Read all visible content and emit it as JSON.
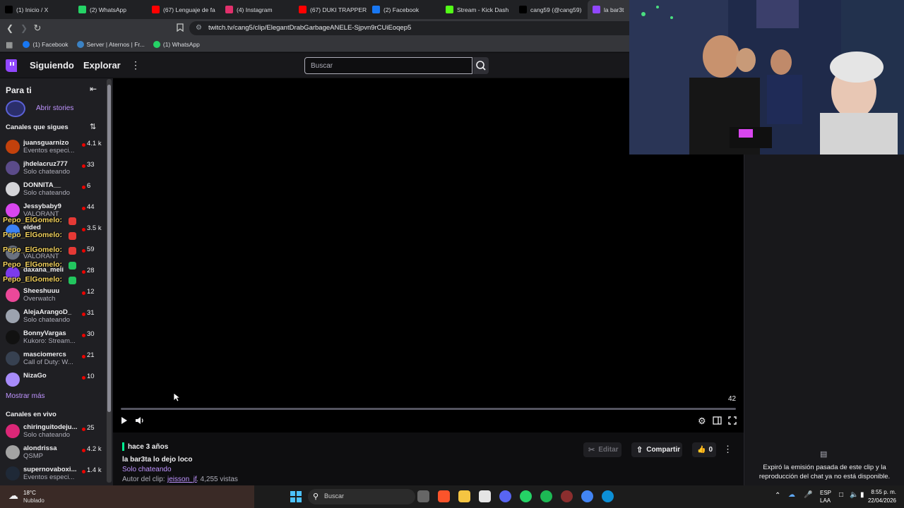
{
  "browser": {
    "tabs": [
      {
        "label": "(1) Inicio / X",
        "icon": "x-icon",
        "color": "#000000"
      },
      {
        "label": "(2) WhatsApp",
        "icon": "whatsapp-icon",
        "color": "#25d366"
      },
      {
        "label": "(67) Lenguaje de fa",
        "icon": "youtube-icon",
        "color": "#ff0000"
      },
      {
        "label": "(4) Instagram",
        "icon": "instagram-icon",
        "color": "#e1306c"
      },
      {
        "label": "(67) DUKI TRAPPER",
        "icon": "youtube-icon",
        "color": "#ff0000"
      },
      {
        "label": "(2) Facebook",
        "icon": "facebook-icon",
        "color": "#1877f2"
      },
      {
        "label": "Stream - Kick Dash",
        "icon": "kick-icon",
        "color": "#53fc18"
      },
      {
        "label": "cang59 (@cang59)",
        "icon": "tiktok-icon",
        "color": "#000000"
      },
      {
        "label": "la bar3t",
        "icon": "twitch-icon",
        "color": "#9147ff"
      }
    ],
    "url": "twitch.tv/cang5/clip/ElegantDrabGarbageANELE-Sjpvn9rCUiEoqep5",
    "bookmarks": [
      {
        "label": "(1) Facebook",
        "color": "#1877f2"
      },
      {
        "label": "Server | Aternos | Fr...",
        "color": "#3b82c4"
      },
      {
        "label": "(1) WhatsApp",
        "color": "#25d366"
      }
    ]
  },
  "nav": {
    "following": "Siguiendo",
    "browse": "Explorar",
    "search_placeholder": "Buscar"
  },
  "sidebar": {
    "for_you": "Para ti",
    "open_stories": "Abrir stories",
    "followed_header": "Canales que sigues",
    "channels": [
      {
        "name": "juansguarnizo",
        "game": "Eventos especi...",
        "viewers": "4.1 k",
        "color": "#c2410c"
      },
      {
        "name": "jhdelacruz777",
        "game": "Solo chateando",
        "viewers": "33",
        "color": "#5b4b8a"
      },
      {
        "name": "DONNITA__",
        "game": "Solo chateando",
        "viewers": "6",
        "color": "#d4d4d8"
      },
      {
        "name": "Jessybaby9",
        "game": "VALORANT",
        "viewers": "44",
        "color": "#d946ef"
      },
      {
        "name": "elded",
        "game": "",
        "viewers": "3.5 k",
        "color": "#3b82f6"
      },
      {
        "name": "",
        "game": "VALORANT",
        "viewers": "59",
        "color": "#6b7280"
      },
      {
        "name": "daxana_meli",
        "game": "",
        "viewers": "28",
        "color": "#7c3aed"
      },
      {
        "name": "Sheeshuuu",
        "game": "Overwatch",
        "viewers": "12",
        "color": "#ec4899"
      },
      {
        "name": "AlejaArangoD_",
        "game": "Solo chateando",
        "viewers": "31",
        "color": "#9ca3af"
      },
      {
        "name": "BonnyVargas",
        "game": "Kukoro: Stream...",
        "viewers": "30",
        "color": "#111111"
      },
      {
        "name": "masciomercs",
        "game": "Call of Duty: W...",
        "viewers": "21",
        "color": "#374151"
      },
      {
        "name": "NizaGo",
        "game": "",
        "viewers": "10",
        "color": "#a78bfa"
      }
    ],
    "show_more": "Mostrar más",
    "live_header": "Canales en vivo",
    "live_channels": [
      {
        "name": "chiringuitodeju...",
        "game": "Solo chateando",
        "viewers": "25",
        "color": "#db2777"
      },
      {
        "name": "alondrissa",
        "game": "QSMP",
        "viewers": "4.2 k",
        "color": "#a3a3a3"
      },
      {
        "name": "supernovaboxi...",
        "game": "Eventos especi...",
        "viewers": "1.4 k",
        "color": "#1f2937"
      }
    ]
  },
  "overlay_chat": [
    "Pepo_ElGomelo:",
    "Pepo_ElGomelo:",
    "Pepo_ElGomelo:",
    "Pepo_ElGomelo:",
    "Pepo_ElGomelo:"
  ],
  "player": {
    "time_remaining": "42",
    "progress": 0
  },
  "clip": {
    "age": "hace 3 años",
    "title": "la bar3ta lo dejo loco",
    "category": "Solo chateando",
    "author_label": "Autor del clip:",
    "author": "jeisson_jf",
    "views": " . 4,255 vistas",
    "edit": "Editar",
    "share": "Compartir",
    "likes": "0"
  },
  "chat_panel": {
    "message": "Expiró la emisión pasada de este clip y la reproducción del chat ya no está disponible."
  },
  "taskbar": {
    "weather_temp": "18°C",
    "weather_desc": "Nublado",
    "search": "Buscar",
    "lang1": "ESP",
    "lang2": "LAA",
    "time": "8:55 p. m.",
    "date": "22/04/2026"
  }
}
